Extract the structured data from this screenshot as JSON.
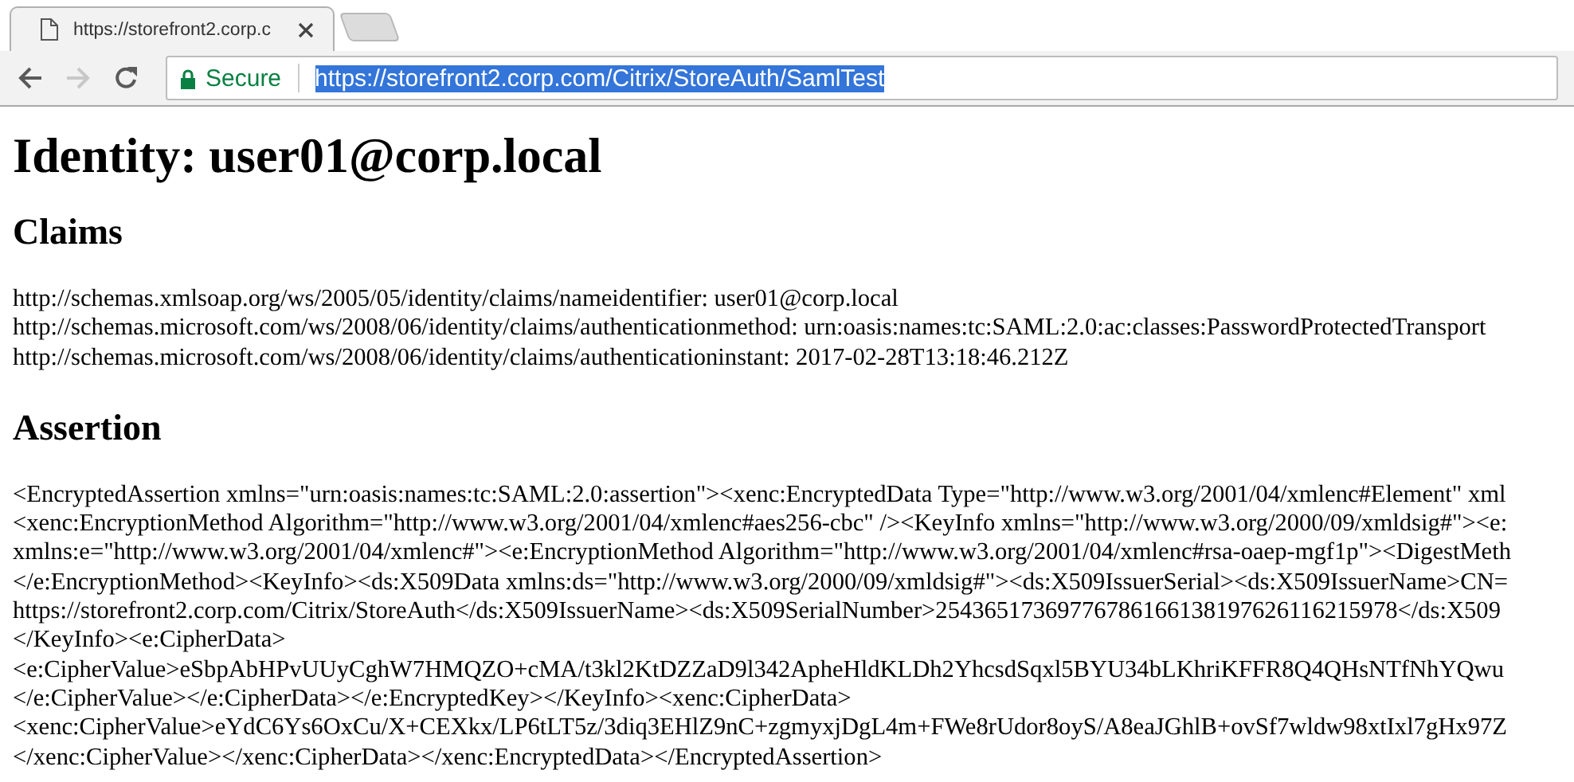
{
  "browser": {
    "tabs": [
      {
        "title": "https://storefront2.corp.c",
        "selected": true
      }
    ],
    "nav_buttons": [
      {
        "kind": "back",
        "disabled": false
      },
      {
        "kind": "forward",
        "disabled": true
      },
      {
        "kind": "reload",
        "disabled": false
      }
    ],
    "address_bar": {
      "security_label": "Secure",
      "url": "https://storefront2.corp.com/Citrix/StoreAuth/SamlTest",
      "url_selected": true
    }
  },
  "page": {
    "title": "Identity: user01@corp.local",
    "sections": [
      {
        "heading": "Claims",
        "lines": [
          "http://schemas.xmlsoap.org/ws/2005/05/identity/claims/nameidentifier: user01@corp.local",
          "http://schemas.microsoft.com/ws/2008/06/identity/claims/authenticationmethod: urn:oasis:names:tc:SAML:2.0:ac:classes:PasswordProtectedTransport",
          "http://schemas.microsoft.com/ws/2008/06/identity/claims/authenticationinstant: 2017-02-28T13:18:46.212Z"
        ]
      },
      {
        "heading": "Assertion",
        "lines": [
          "<EncryptedAssertion xmlns=\"urn:oasis:names:tc:SAML:2.0:assertion\"><xenc:EncryptedData Type=\"http://www.w3.org/2001/04/xmlenc#Element\" xml",
          "<xenc:EncryptionMethod Algorithm=\"http://www.w3.org/2001/04/xmlenc#aes256-cbc\" /><KeyInfo xmlns=\"http://www.w3.org/2000/09/xmldsig#\"><e:",
          "xmlns:e=\"http://www.w3.org/2001/04/xmlenc#\"><e:EncryptionMethod Algorithm=\"http://www.w3.org/2001/04/xmlenc#rsa-oaep-mgf1p\"><DigestMeth",
          "</e:EncryptionMethod><KeyInfo><ds:X509Data xmlns:ds=\"http://www.w3.org/2000/09/xmldsig#\"><ds:X509IssuerSerial><ds:X509IssuerName>CN=",
          "https://storefront2.corp.com/Citrix/StoreAuth</ds:X509IssuerName><ds:X509SerialNumber>25436517369776786166138197626116215978</ds:X509",
          "</KeyInfo><e:CipherData>",
          "<e:CipherValue>eSbpAbHPvUUyCghW7HMQZO+cMA/t3kl2KtDZZaD9l342ApheHldKLDh2YhcsdSqxl5BYU34bLKhriKFFR8Q4QHsNTfNhYQwu",
          "</e:CipherValue></e:CipherData></e:EncryptedKey></KeyInfo><xenc:CipherData>",
          "<xenc:CipherValue>eYdC6Ys6OxCu/X+CEXkx/LP6tLT5z/3diq3EHlZ9nC+zgmyxjDgL4m+FWe8rUdor8oyS/A8eaJGhlB+ovSf7wldw98xtIxl7gHx97Z",
          "</xenc:CipherValue></xenc:CipherData></xenc:EncryptedData></EncryptedAssertion>"
        ]
      }
    ]
  }
}
